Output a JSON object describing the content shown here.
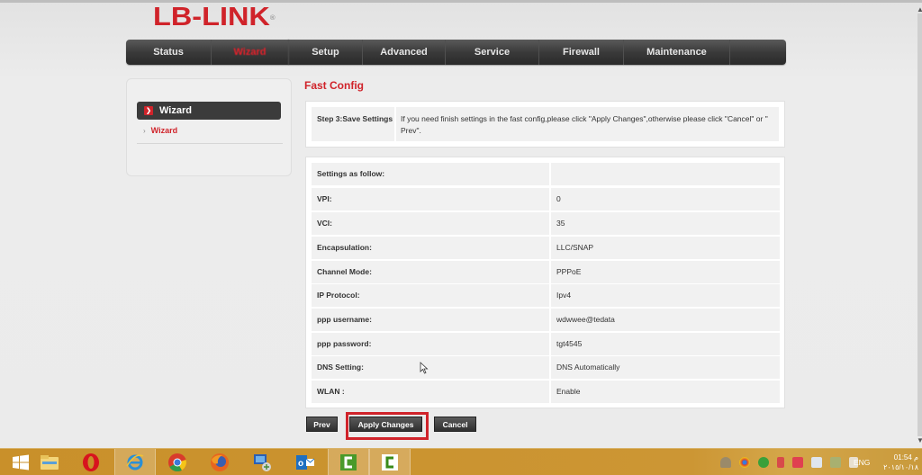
{
  "brand": {
    "logo_text": "LB-LINK",
    "registered_mark": "®",
    "accent_color": "#d0232a"
  },
  "nav": {
    "items": [
      {
        "label": "Status",
        "active": false
      },
      {
        "label": "Wizard",
        "active": true
      },
      {
        "label": "Setup",
        "active": false
      },
      {
        "label": "Advanced",
        "active": false
      },
      {
        "label": "Service",
        "active": false
      },
      {
        "label": "Firewall",
        "active": false
      },
      {
        "label": "Maintenance",
        "active": false
      }
    ]
  },
  "sidebar": {
    "header": "Wizard",
    "header_icon": "chevron-right-icon",
    "links": [
      {
        "label": "Wizard",
        "icon": "chevron-right-icon"
      }
    ]
  },
  "main": {
    "title": "Fast Config",
    "step": {
      "label": "Step 3:Save Settings",
      "description": "If you need finish settings in the fast config,please click \"Apply Changes\",otherwise please click \"Cancel\" or \" Prev\"."
    },
    "settings_header": "Settings as follow:",
    "settings": [
      {
        "key": "VPI:",
        "value": "0"
      },
      {
        "key": "VCI:",
        "value": "35"
      },
      {
        "key": "Encapsulation:",
        "value": "LLC/SNAP"
      },
      {
        "key": "Channel Mode:",
        "value": "PPPoE"
      },
      {
        "key": "IP Protocol:",
        "value": "Ipv4"
      },
      {
        "key": "ppp username:",
        "value": "wdwwee@tedata"
      },
      {
        "key": "ppp password:",
        "value": "tgt4545"
      },
      {
        "key": "DNS Setting:",
        "value": "DNS Automatically"
      },
      {
        "key": "WLAN :",
        "value": "Enable"
      }
    ],
    "buttons": {
      "prev": "Prev",
      "apply": "Apply Changes",
      "cancel": "Cancel"
    }
  },
  "taskbar": {
    "apps": [
      {
        "name": "start-button",
        "icon": "windows-logo-icon"
      },
      {
        "name": "file-explorer",
        "icon": "folder-icon"
      },
      {
        "name": "opera",
        "icon": "opera-icon"
      },
      {
        "name": "internet-explorer",
        "icon": "ie-icon",
        "active": true
      },
      {
        "name": "chrome",
        "icon": "chrome-icon"
      },
      {
        "name": "firefox",
        "icon": "firefox-icon"
      },
      {
        "name": "remote-desktop",
        "icon": "computer-icon"
      },
      {
        "name": "outlook",
        "icon": "outlook-icon"
      },
      {
        "name": "camtasia-recorder",
        "icon": "camtasia-green-icon"
      },
      {
        "name": "camtasia-studio",
        "icon": "camtasia-white-icon"
      }
    ],
    "tray": {
      "language": "ENG",
      "time": "01:54 م",
      "date": "٢٠١٥/١٠/١٨"
    }
  }
}
